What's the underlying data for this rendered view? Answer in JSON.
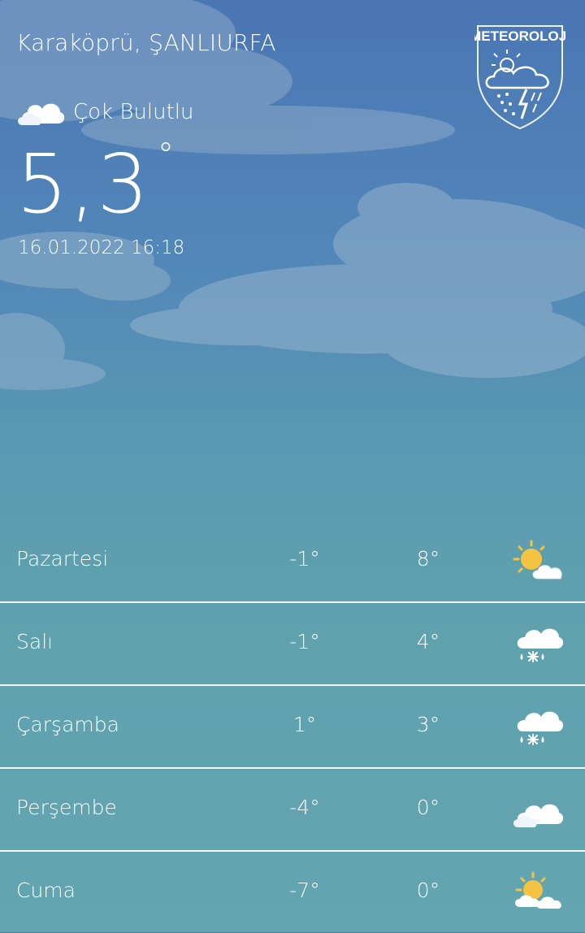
{
  "header": {
    "location": "Karaköprü,  ŞANLIURFA",
    "logo_text": "METEOROLOJi"
  },
  "current": {
    "condition": "Çok Bulutlu",
    "condition_icon": "cloudy-icon",
    "temperature": "5,3",
    "degree_symbol": "°",
    "datetime": "16.01.2022 16:18"
  },
  "forecast": [
    {
      "day": "Pazartesi",
      "min": "-1°",
      "max": "8°",
      "icon": "partly-sunny-icon"
    },
    {
      "day": "Salı",
      "min": "-1°",
      "max": "4°",
      "icon": "sleet-icon"
    },
    {
      "day": "Çarşamba",
      "min": "1°",
      "max": "3°",
      "icon": "sleet-icon"
    },
    {
      "day": "Perşembe",
      "min": "-4°",
      "max": "0°",
      "icon": "cloudy-icon"
    },
    {
      "day": "Cuma",
      "min": "-7°",
      "max": "0°",
      "icon": "partly-sunny-icon"
    }
  ],
  "colors": {
    "sky_top": "#4a76b4",
    "sky_bottom": "#63a5b0",
    "sun": "#f5c342",
    "text": "#ffffff"
  }
}
